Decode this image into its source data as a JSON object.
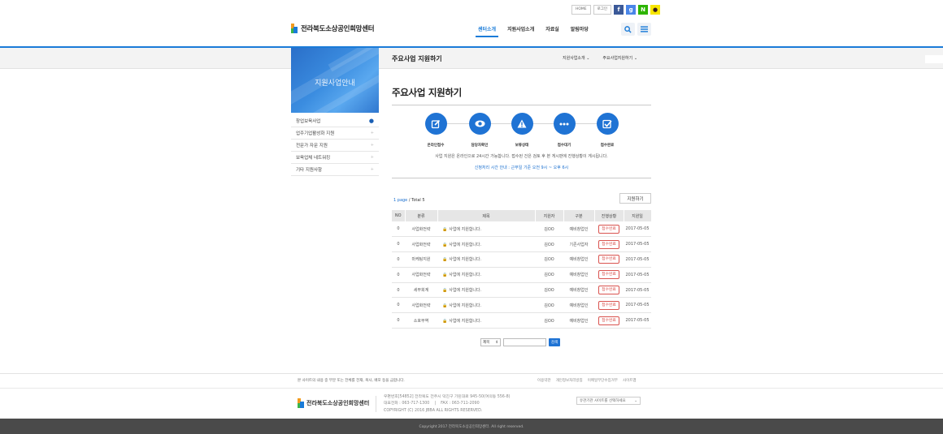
{
  "util": {
    "home": "HOME",
    "login": "로그인",
    "social": [
      {
        "name": "facebook",
        "glyph": "f",
        "color": "#3b5998"
      },
      {
        "name": "google-plus",
        "glyph": "g",
        "color": "#4a86e8"
      },
      {
        "name": "naver",
        "glyph": "N",
        "color": "#2db400"
      },
      {
        "name": "kakao",
        "glyph": "●",
        "color": "#f7e600"
      }
    ]
  },
  "header": {
    "logo_text": "전라북도소상공인희망센터",
    "nav": [
      "센터소개",
      "지원사업소개",
      "자료실",
      "알림마당"
    ]
  },
  "sidebar": {
    "title": "지원사업안내",
    "items": [
      {
        "label": "창업보육사업",
        "active": true
      },
      {
        "label": "업주기업활성화 지원",
        "active": false
      },
      {
        "label": "전문가 자문 지원",
        "active": false
      },
      {
        "label": "보육업체 네트워킹",
        "active": false
      },
      {
        "label": "기타 지원사항",
        "active": false
      }
    ]
  },
  "content": {
    "small_title": "주요사업 지원하기",
    "crumb1": "지원사업소개",
    "crumb2": "주요사업지원하기",
    "title": "주요사업 지원하기",
    "steps": [
      "온라인접수",
      "담당자확인",
      "보류상태",
      "접수대기",
      "접수완료"
    ],
    "note1": "사업 지원은 온라인으로 24시간 가능합니다. 접수된 건은 검토 후 본 게시판에 진행상황이 게시됩니다.",
    "note2": "신청처리 시간 안내 : 근무일 기준 오전 9시 ~ 오후 6시",
    "page_label": "1 page",
    "total_label": "/ Total 5",
    "apply_button": "지원하기",
    "columns": [
      "NO",
      "분류",
      "제목",
      "지원자",
      "구분",
      "진행상황",
      "지원일"
    ],
    "rows": [
      {
        "no": "0",
        "cat": "사업화전략",
        "title": "사업에 지원합니다.",
        "applicant": "김OO",
        "type": "예비창업인",
        "status": "접수완료",
        "date": "2017-05-05"
      },
      {
        "no": "0",
        "cat": "사업화전략",
        "title": "사업에 지원합니다.",
        "applicant": "김OO",
        "type": "기존사업자",
        "status": "접수완료",
        "date": "2017-05-05"
      },
      {
        "no": "0",
        "cat": "마케팅지원",
        "title": "사업에 지원합니다.",
        "applicant": "김OO",
        "type": "예비창업인",
        "status": "접수완료",
        "date": "2017-05-05"
      },
      {
        "no": "0",
        "cat": "사업화전략",
        "title": "사업에 지원합니다.",
        "applicant": "김OO",
        "type": "예비창업인",
        "status": "접수완료",
        "date": "2017-05-05"
      },
      {
        "no": "0",
        "cat": "세무회계",
        "title": "사업에 지원합니다.",
        "applicant": "김OO",
        "type": "예비창업인",
        "status": "접수완료",
        "date": "2017-05-05"
      },
      {
        "no": "0",
        "cat": "사업화전략",
        "title": "사업에 지원합니다.",
        "applicant": "김OO",
        "type": "예비창업인",
        "status": "접수완료",
        "date": "2017-05-05"
      },
      {
        "no": "0",
        "cat": "소호무역",
        "title": "사업에 지원합니다.",
        "applicant": "김OO",
        "type": "예비창업인",
        "status": "접수완료",
        "date": "2017-05-05"
      }
    ],
    "search_select": "제목",
    "search_button": "검색"
  },
  "footer": {
    "notice": "본 사이트의 내용 중 부분 또는 전체를 전재, 복사, 배포 등을 금합니다.",
    "links": [
      "이용약관",
      "개인정보처리방침",
      "이메일무단수집거부",
      "사이트맵"
    ],
    "logo_text": "전라북도소상공인희망센터",
    "address": "우편번호[54852] 전라북도 전주시 덕진구 기린대로 945-50(여의동 556-8)",
    "phone": "대표전화 : 063-717-1300    |    FAX : 063-711-2090",
    "copyright_small": "COPYRIGHT (C) 2016 JBBA ALL RIGHTS RESERVED.",
    "site_select": "유관기관 사이트를 선택하세요",
    "bottom": "Copyright 2017  전라북도소상공인희망센터. All right reserved."
  },
  "colors": {
    "accent": "#1a7bd8",
    "badge": "#d9534f"
  }
}
